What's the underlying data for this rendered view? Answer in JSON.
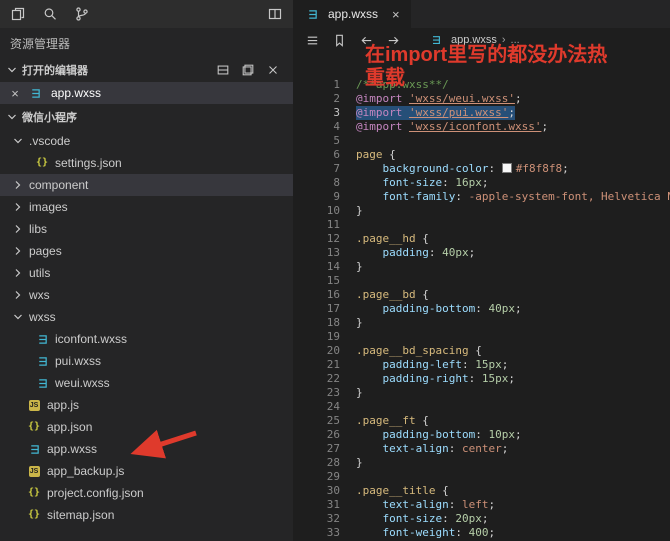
{
  "colors": {
    "annotation_red": "#df3a2c",
    "wxss_icon_teal": "#42b8d4",
    "selection_blue": "#264f78",
    "row_highlight": "#37373d",
    "editor_background": "#1e1e1e",
    "sidebar_background": "#252526"
  },
  "glyphs": {
    "close": "×",
    "breadcrumb_separator": "›",
    "breadcrumb_more": "..."
  },
  "topbar": {
    "left_icons": [
      "files-icon",
      "search-icon",
      "git-branch-icon"
    ],
    "right_icons": [
      "split-editor-icon"
    ]
  },
  "sidebar": {
    "title": "资源管理器",
    "open_editors": {
      "label": "打开的编辑器",
      "action_icons": [
        "toggle-layout-icon",
        "save-all-icon",
        "close-all-editors-icon"
      ],
      "items": [
        {
          "label": "app.wxss",
          "icon": "wxss",
          "active": true
        }
      ]
    },
    "project": {
      "label": "微信小程序",
      "tree": [
        {
          "label": ".vscode",
          "kind": "folder",
          "expanded": true,
          "level": 0
        },
        {
          "label": "settings.json",
          "kind": "file",
          "icon": "json",
          "level": 1
        },
        {
          "label": "component",
          "kind": "folder",
          "expanded": false,
          "level": 0,
          "highlighted": true
        },
        {
          "label": "images",
          "kind": "folder",
          "expanded": false,
          "level": 0
        },
        {
          "label": "libs",
          "kind": "folder",
          "expanded": false,
          "level": 0
        },
        {
          "label": "pages",
          "kind": "folder",
          "expanded": false,
          "level": 0
        },
        {
          "label": "utils",
          "kind": "folder",
          "expanded": false,
          "level": 0
        },
        {
          "label": "wxs",
          "kind": "folder",
          "expanded": false,
          "level": 0
        },
        {
          "label": "wxss",
          "kind": "folder",
          "expanded": true,
          "level": 0
        },
        {
          "label": "iconfont.wxss",
          "kind": "file",
          "icon": "wxss",
          "level": 1
        },
        {
          "label": "pui.wxss",
          "kind": "file",
          "icon": "wxss",
          "level": 1
        },
        {
          "label": "weui.wxss",
          "kind": "file",
          "icon": "wxss",
          "level": 1
        },
        {
          "label": "app.js",
          "kind": "file",
          "icon": "js",
          "level": 0
        },
        {
          "label": "app.json",
          "kind": "file",
          "icon": "json",
          "level": 0
        },
        {
          "label": "app.wxss",
          "kind": "file",
          "icon": "wxss",
          "level": 0,
          "arrow_target": true
        },
        {
          "label": "app_backup.js",
          "kind": "file",
          "icon": "js",
          "level": 0
        },
        {
          "label": "project.config.json",
          "kind": "file",
          "icon": "json",
          "level": 0
        },
        {
          "label": "sitemap.json",
          "kind": "file",
          "icon": "json",
          "level": 0
        }
      ]
    }
  },
  "editor": {
    "tab": {
      "label": "app.wxss",
      "icon": "wxss"
    },
    "toolbar_icons": [
      "list-icon",
      "bookmark-icon",
      "arrow-left-icon",
      "arrow-right-icon"
    ],
    "breadcrumb": {
      "file": "app.wxss"
    },
    "annotation": {
      "text": "在import里写的都没办法热重载"
    },
    "code": {
      "language": "wxss",
      "selected_line": 3,
      "lines": [
        {
          "segs": [
            {
              "c": "cm",
              "t": "/**app.wxss**/"
            }
          ]
        },
        {
          "segs": [
            {
              "c": "kw",
              "t": "@import"
            },
            {
              "c": "pun",
              "t": " "
            },
            {
              "c": "str",
              "t": "'wxss/weui.wxss'"
            },
            {
              "c": "pun",
              "t": ";"
            }
          ]
        },
        {
          "selected": true,
          "segs": [
            {
              "c": "kw",
              "t": "@import"
            },
            {
              "c": "pun",
              "t": " "
            },
            {
              "c": "str",
              "t": "'wxss/pui.wxss'"
            },
            {
              "c": "pun",
              "t": ";"
            }
          ]
        },
        {
          "segs": [
            {
              "c": "kw",
              "t": "@import"
            },
            {
              "c": "pun",
              "t": " "
            },
            {
              "c": "str",
              "t": "'wxss/iconfont.wxss'"
            },
            {
              "c": "pun",
              "t": ";"
            }
          ]
        },
        {
          "segs": []
        },
        {
          "segs": [
            {
              "c": "sel",
              "t": "page"
            },
            {
              "c": "pun",
              "t": " {"
            }
          ]
        },
        {
          "segs": [
            {
              "c": "pun",
              "t": "    "
            },
            {
              "c": "prop",
              "t": "background-color"
            },
            {
              "c": "pun",
              "t": ": "
            },
            {
              "c": "sw"
            },
            {
              "c": "val",
              "t": "#f8f8f8"
            },
            {
              "c": "pun",
              "t": ";"
            }
          ]
        },
        {
          "segs": [
            {
              "c": "pun",
              "t": "    "
            },
            {
              "c": "prop",
              "t": "font-size"
            },
            {
              "c": "pun",
              "t": ": "
            },
            {
              "c": "num",
              "t": "16px"
            },
            {
              "c": "pun",
              "t": ";"
            }
          ]
        },
        {
          "segs": [
            {
              "c": "pun",
              "t": "    "
            },
            {
              "c": "prop",
              "t": "font-family"
            },
            {
              "c": "pun",
              "t": ": "
            },
            {
              "c": "val",
              "t": "-apple-system-font, Helvetica N"
            }
          ]
        },
        {
          "segs": [
            {
              "c": "pun",
              "t": "}"
            }
          ]
        },
        {
          "segs": []
        },
        {
          "segs": [
            {
              "c": "sel",
              "t": ".page__hd"
            },
            {
              "c": "pun",
              "t": " {"
            }
          ]
        },
        {
          "segs": [
            {
              "c": "pun",
              "t": "    "
            },
            {
              "c": "prop",
              "t": "padding"
            },
            {
              "c": "pun",
              "t": ": "
            },
            {
              "c": "num",
              "t": "40px"
            },
            {
              "c": "pun",
              "t": ";"
            }
          ]
        },
        {
          "segs": [
            {
              "c": "pun",
              "t": "}"
            }
          ]
        },
        {
          "segs": []
        },
        {
          "segs": [
            {
              "c": "sel",
              "t": ".page__bd"
            },
            {
              "c": "pun",
              "t": " {"
            }
          ]
        },
        {
          "segs": [
            {
              "c": "pun",
              "t": "    "
            },
            {
              "c": "prop",
              "t": "padding-bottom"
            },
            {
              "c": "pun",
              "t": ": "
            },
            {
              "c": "num",
              "t": "40px"
            },
            {
              "c": "pun",
              "t": ";"
            }
          ]
        },
        {
          "segs": [
            {
              "c": "pun",
              "t": "}"
            }
          ]
        },
        {
          "segs": []
        },
        {
          "segs": [
            {
              "c": "sel",
              "t": ".page__bd_spacing"
            },
            {
              "c": "pun",
              "t": " {"
            }
          ]
        },
        {
          "segs": [
            {
              "c": "pun",
              "t": "    "
            },
            {
              "c": "prop",
              "t": "padding-left"
            },
            {
              "c": "pun",
              "t": ": "
            },
            {
              "c": "num",
              "t": "15px"
            },
            {
              "c": "pun",
              "t": ";"
            }
          ]
        },
        {
          "segs": [
            {
              "c": "pun",
              "t": "    "
            },
            {
              "c": "prop",
              "t": "padding-right"
            },
            {
              "c": "pun",
              "t": ": "
            },
            {
              "c": "num",
              "t": "15px"
            },
            {
              "c": "pun",
              "t": ";"
            }
          ]
        },
        {
          "segs": [
            {
              "c": "pun",
              "t": "}"
            }
          ]
        },
        {
          "segs": []
        },
        {
          "segs": [
            {
              "c": "sel",
              "t": ".page__ft"
            },
            {
              "c": "pun",
              "t": " {"
            }
          ]
        },
        {
          "segs": [
            {
              "c": "pun",
              "t": "    "
            },
            {
              "c": "prop",
              "t": "padding-bottom"
            },
            {
              "c": "pun",
              "t": ": "
            },
            {
              "c": "num",
              "t": "10px"
            },
            {
              "c": "pun",
              "t": ";"
            }
          ]
        },
        {
          "segs": [
            {
              "c": "pun",
              "t": "    "
            },
            {
              "c": "prop",
              "t": "text-align"
            },
            {
              "c": "pun",
              "t": ": "
            },
            {
              "c": "val",
              "t": "center"
            },
            {
              "c": "pun",
              "t": ";"
            }
          ]
        },
        {
          "segs": [
            {
              "c": "pun",
              "t": "}"
            }
          ]
        },
        {
          "segs": []
        },
        {
          "segs": [
            {
              "c": "sel",
              "t": ".page__title"
            },
            {
              "c": "pun",
              "t": " {"
            }
          ]
        },
        {
          "segs": [
            {
              "c": "pun",
              "t": "    "
            },
            {
              "c": "prop",
              "t": "text-align"
            },
            {
              "c": "pun",
              "t": ": "
            },
            {
              "c": "val",
              "t": "left"
            },
            {
              "c": "pun",
              "t": ";"
            }
          ]
        },
        {
          "segs": [
            {
              "c": "pun",
              "t": "    "
            },
            {
              "c": "prop",
              "t": "font-size"
            },
            {
              "c": "pun",
              "t": ": "
            },
            {
              "c": "num",
              "t": "20px"
            },
            {
              "c": "pun",
              "t": ";"
            }
          ]
        },
        {
          "segs": [
            {
              "c": "pun",
              "t": "    "
            },
            {
              "c": "prop",
              "t": "font-weight"
            },
            {
              "c": "pun",
              "t": ": "
            },
            {
              "c": "num",
              "t": "400"
            },
            {
              "c": "pun",
              "t": ";"
            }
          ]
        }
      ]
    }
  }
}
